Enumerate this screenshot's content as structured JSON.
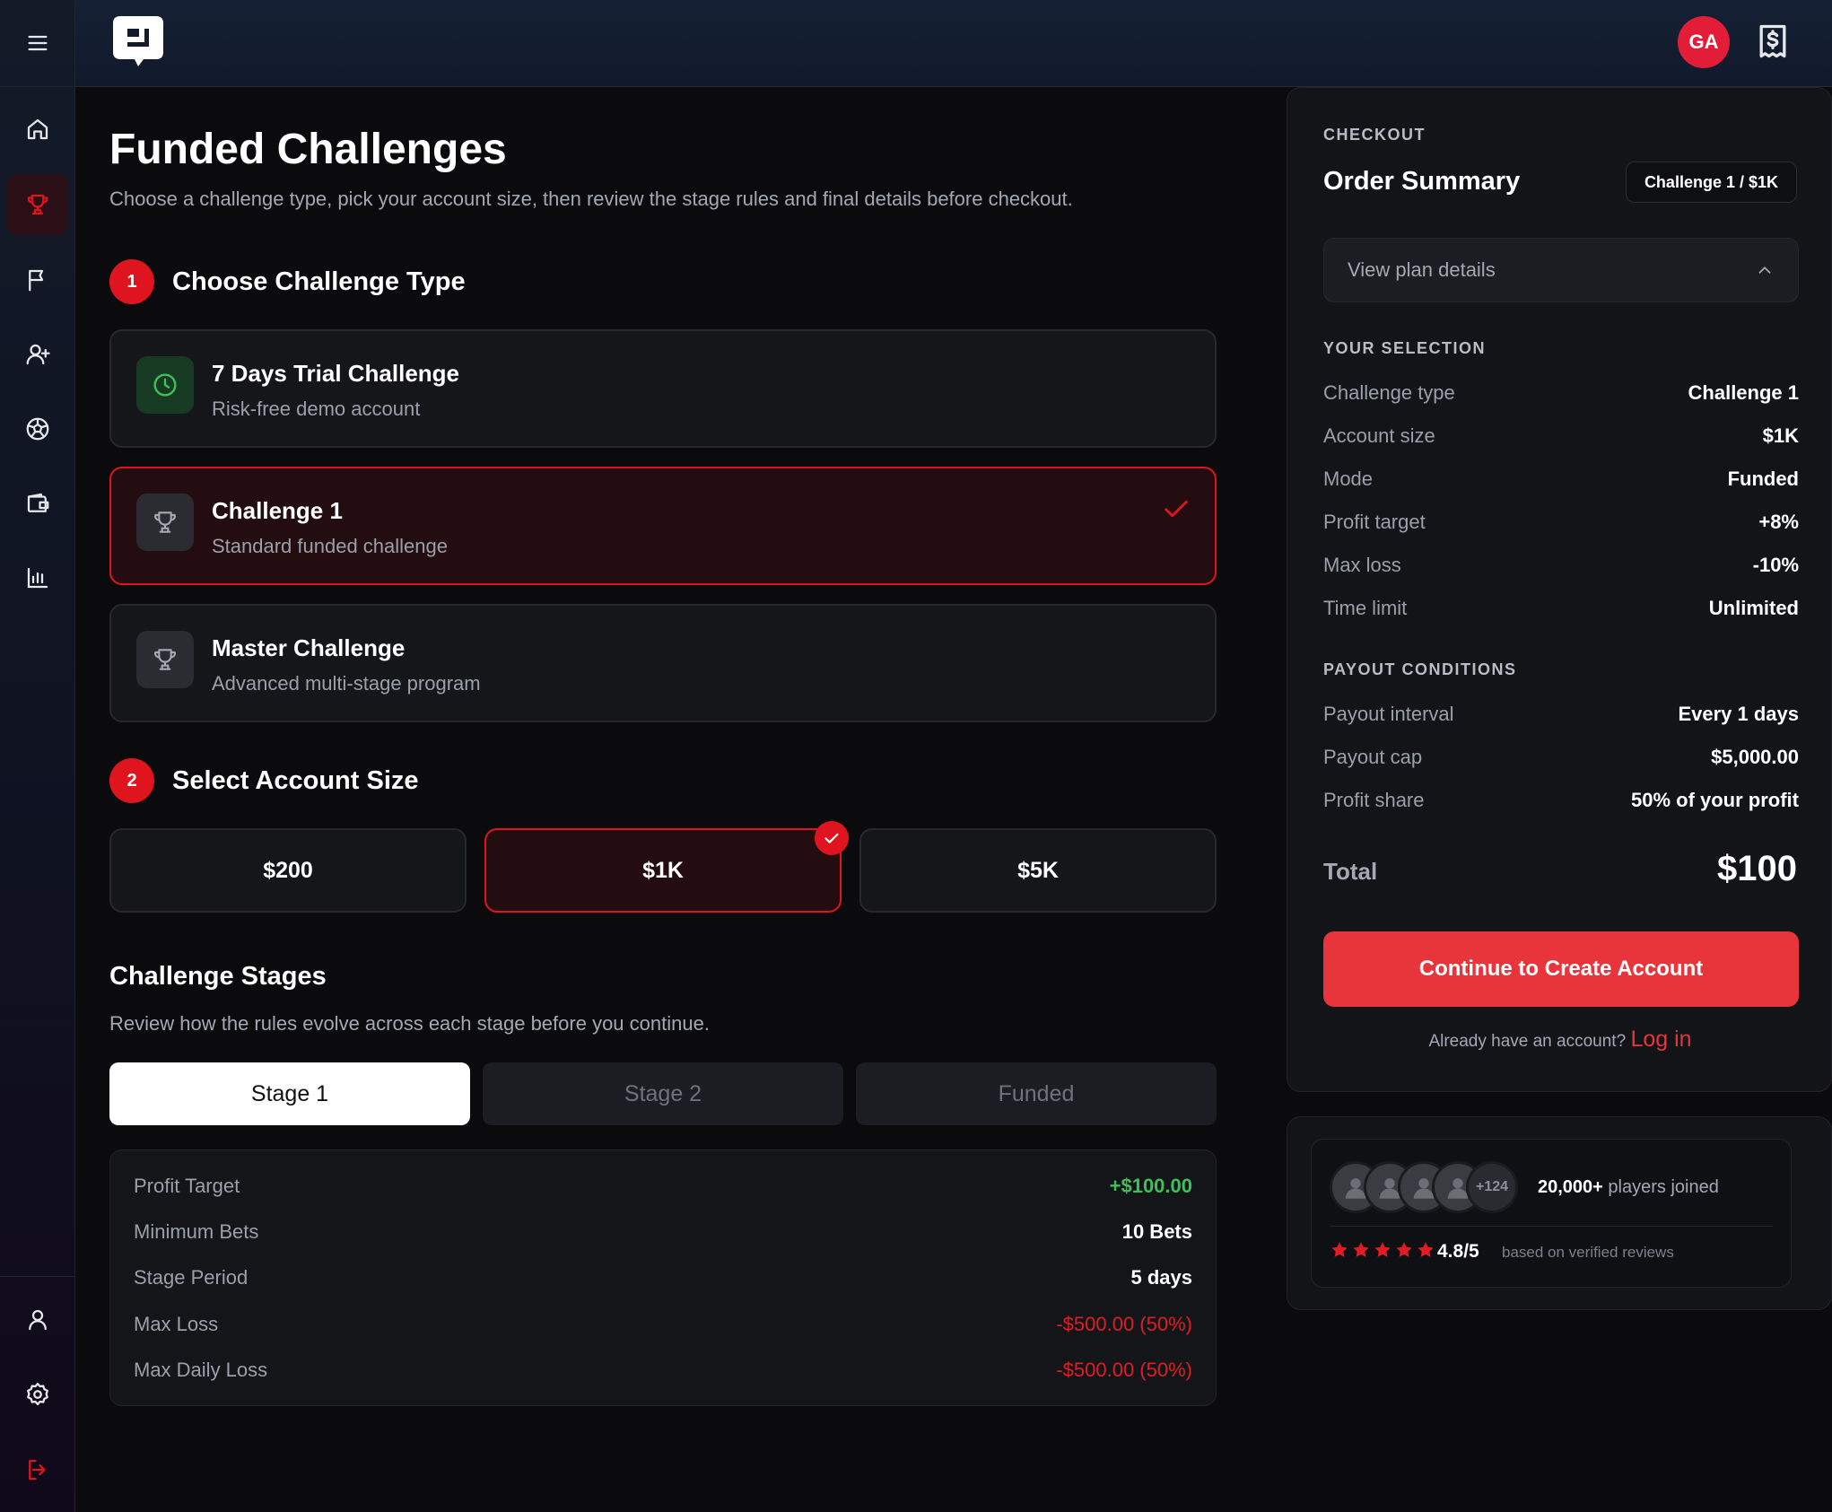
{
  "header": {
    "avatar_initials": "GA"
  },
  "main": {
    "title": "Funded Challenges",
    "subtitle": "Choose a challenge type, pick your account size, then review the stage rules and final details before checkout.",
    "step1": {
      "number": "1",
      "title": "Choose Challenge Type"
    },
    "challenge_types": [
      {
        "title": "7 Days Trial Challenge",
        "subtitle": "Risk-free demo account",
        "icon": "clock-icon",
        "selected": false
      },
      {
        "title": "Challenge 1",
        "subtitle": "Standard funded challenge",
        "icon": "trophy-icon",
        "selected": true
      },
      {
        "title": "Master Challenge",
        "subtitle": "Advanced multi-stage program",
        "icon": "trophy-icon",
        "selected": false
      }
    ],
    "step2": {
      "number": "2",
      "title": "Select Account Size"
    },
    "account_sizes": [
      {
        "label": "$200",
        "selected": false
      },
      {
        "label": "$1K",
        "selected": true
      },
      {
        "label": "$5K",
        "selected": false
      }
    ],
    "stages": {
      "title": "Challenge Stages",
      "subtitle": "Review how the rules evolve across each stage before you continue.",
      "tabs": [
        "Stage 1",
        "Stage 2",
        "Funded"
      ],
      "active_tab": "Stage 1",
      "rules": [
        {
          "label": "Profit Target",
          "value": "+$100.00",
          "tone": "green"
        },
        {
          "label": "Minimum Bets",
          "value": "10 Bets",
          "tone": "white"
        },
        {
          "label": "Stage Period",
          "value": "5 days",
          "tone": "white"
        },
        {
          "label": "Max Loss",
          "value": "-$500.00 (50%)",
          "tone": "red"
        },
        {
          "label": "Max Daily Loss",
          "value": "-$500.00 (50%)",
          "tone": "red"
        }
      ]
    }
  },
  "checkout": {
    "eyebrow": "CHECKOUT",
    "title": "Order Summary",
    "chip": "Challenge 1 / $1K",
    "details_label": "View plan details",
    "selection_heading": "YOUR SELECTION",
    "selection": [
      {
        "label": "Challenge type",
        "value": "Challenge 1",
        "tone": "white"
      },
      {
        "label": "Account size",
        "value": "$1K",
        "tone": "white"
      },
      {
        "label": "Mode",
        "value": "Funded",
        "tone": "white"
      },
      {
        "label": "Profit target",
        "value": "+8%",
        "tone": "white"
      },
      {
        "label": "Max loss",
        "value": "-10%",
        "tone": "red"
      },
      {
        "label": "Time limit",
        "value": "Unlimited",
        "tone": "white"
      }
    ],
    "payout_heading": "PAYOUT CONDITIONS",
    "payout": [
      {
        "label": "Payout interval",
        "value": "Every 1 days",
        "tone": "green"
      },
      {
        "label": "Payout cap",
        "value": "$5,000.00",
        "tone": "green"
      },
      {
        "label": "Profit share",
        "value": "50% of your profit",
        "tone": "green"
      }
    ],
    "total_label": "Total",
    "total_value": "$100",
    "cta": "Continue to Create Account",
    "login_prompt": "Already have an account?",
    "login_link": "Log in"
  },
  "social": {
    "more_count": "+124",
    "joined_count": "20,000+",
    "joined_text": "players joined",
    "rating": "4.8/5",
    "rating_sub": "based on verified reviews",
    "stars": 5
  },
  "colors": {
    "accent": "#e0141e",
    "cta": "#e8343b",
    "green": "#3fbf5a",
    "background": "#0b0b0d"
  }
}
